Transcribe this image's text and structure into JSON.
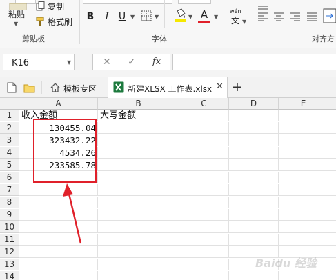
{
  "ribbon": {
    "paste_label": "粘贴",
    "copy_label": "复制",
    "format_painter_label": "格式刷",
    "clipboard_group": "剪贴板",
    "font_group": "字体",
    "align_group": "对齐方",
    "bold": "B",
    "italic": "I",
    "underline": "U",
    "font_color_glyph": "A",
    "wen_glyph": "wén",
    "wen_char": "文",
    "fill_color": "#f5e800",
    "font_color": "#e0202a"
  },
  "formula_bar": {
    "name_box": "K16",
    "fx_label": "fx",
    "formula": ""
  },
  "tabs": {
    "template_tab": "模板专区",
    "file_tab": "新建XLSX 工作表.xlsx",
    "close_glyph": "✕",
    "add_glyph": "+"
  },
  "sheet": {
    "columns": [
      "A",
      "B",
      "C",
      "D",
      "E"
    ],
    "rows": [
      "1",
      "2",
      "3",
      "4",
      "5",
      "6",
      "7",
      "8",
      "9",
      "10",
      "11",
      "12",
      "13",
      "14"
    ],
    "a1": "收入金额",
    "b1": "大写金额",
    "values": [
      "130455.04",
      "323432.22",
      "4534.26",
      "233585.78"
    ]
  },
  "annotation": {
    "highlight_color": "#e0202a"
  },
  "watermark": "Baidu 经验"
}
